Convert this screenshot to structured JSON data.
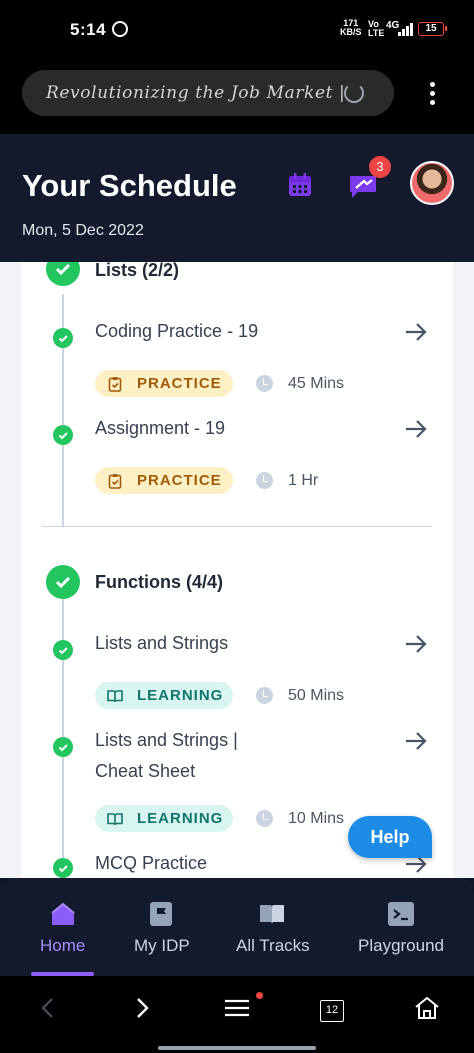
{
  "status_bar": {
    "time": "5:14",
    "net_speed": "171",
    "net_unit": "KB/S",
    "volte": "Vo",
    "volte2": "LTE",
    "signal": "4G",
    "battery": "15"
  },
  "browser": {
    "url_text": "Revolutionizing the Job Market |..."
  },
  "header": {
    "title": "Your Schedule",
    "date": "Mon, 5 Dec 2022",
    "notification_count": "3"
  },
  "sections": [
    {
      "title": "Lists (2/2)",
      "items": [
        {
          "title": "Coding Practice - 19",
          "tag": "PRACTICE",
          "duration": "45 Mins"
        },
        {
          "title": "Assignment - 19",
          "tag": "PRACTICE",
          "duration": "1 Hr"
        }
      ]
    },
    {
      "title": "Functions (4/4)",
      "items": [
        {
          "title": "Lists and Strings",
          "tag": "LEARNING",
          "duration": "50 Mins"
        },
        {
          "title_line1": "Lists and Strings |",
          "title_line2": "Cheat Sheet",
          "tag": "LEARNING",
          "duration": "10 Mins"
        },
        {
          "title": "MCQ Practice"
        }
      ]
    }
  ],
  "help_button": "Help",
  "bottom_nav": {
    "items": [
      {
        "label": "Home",
        "icon": "home-icon",
        "active": true
      },
      {
        "label": "My IDP",
        "icon": "flag-icon"
      },
      {
        "label": "All Tracks",
        "icon": "book-icon"
      },
      {
        "label": "Playground",
        "icon": "terminal-icon"
      }
    ]
  },
  "system_nav": {
    "tabs_count": "12"
  },
  "colors": {
    "header_bg": "#131a2e",
    "accent_purple": "#8b5cf6",
    "success_green": "#22c55e",
    "practice_bg": "#fdf0c4",
    "learning_bg": "#d8f5ef",
    "help_blue": "#1d8ce6"
  }
}
